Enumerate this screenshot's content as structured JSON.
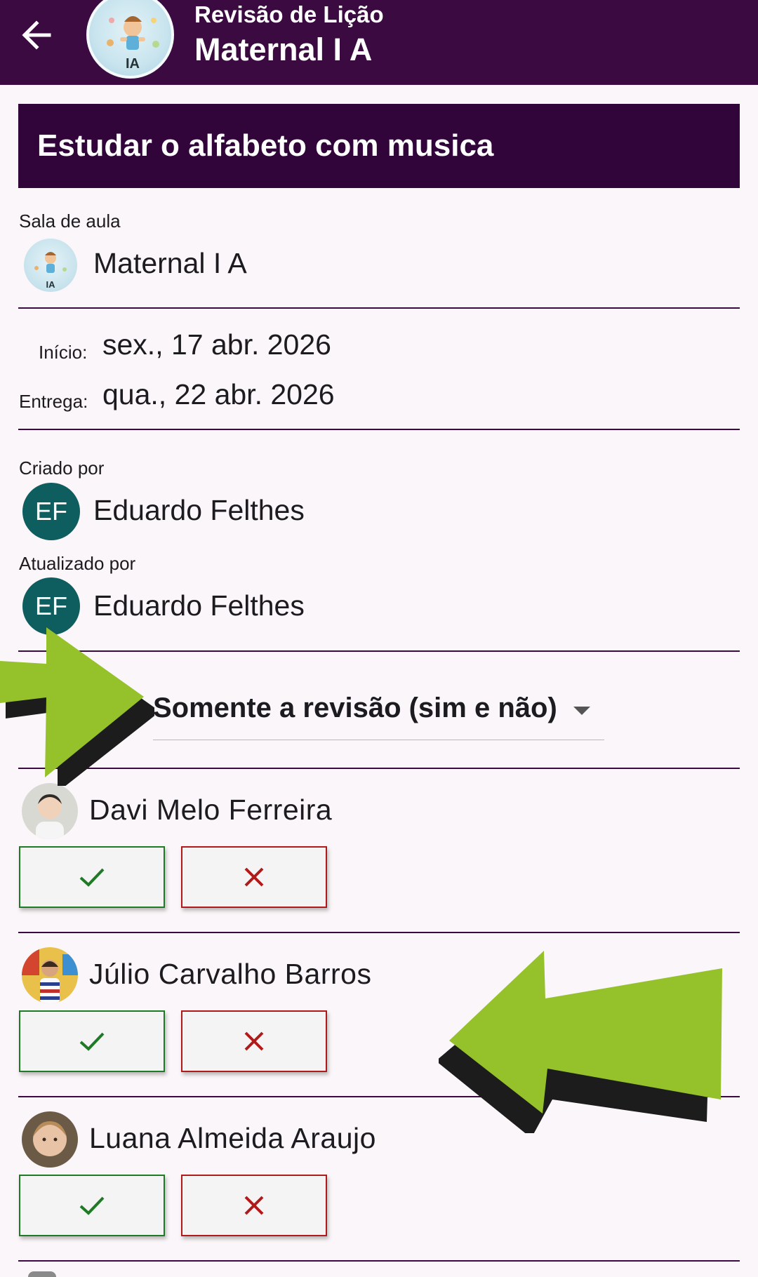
{
  "appbar": {
    "subtitle": "Revisão de Lição",
    "title": "Maternal I A",
    "avatar_text": "IA"
  },
  "lesson": {
    "title": "Estudar o alfabeto com musica"
  },
  "classroom": {
    "label": "Sala de aula",
    "name": "Maternal I A",
    "avatar_text": "IA"
  },
  "dates": {
    "start_label": "Início:",
    "start_value": "sex., 17 abr. 2026",
    "due_label": "Entrega:",
    "due_value": "qua., 22 abr. 2026"
  },
  "created_by": {
    "label": "Criado por",
    "initials": "EF",
    "name": "Eduardo Felthes"
  },
  "updated_by": {
    "label": "Atualizado por",
    "initials": "EF",
    "name": "Eduardo Felthes"
  },
  "filter": {
    "selected": "Somente a revisão (sim e não)"
  },
  "students": [
    {
      "name": "Davi Melo Ferreira"
    },
    {
      "name": "Júlio Carvalho Barros"
    },
    {
      "name": "Luana Almeida Araujo"
    }
  ],
  "icons": {
    "back": "arrow-left-icon",
    "yes": "check-icon",
    "no": "close-icon",
    "caret": "caret-down-icon"
  },
  "colors": {
    "appbar": "#3a0a40",
    "banner": "#31043a",
    "avatar": "#0e5d5f",
    "yes": "#1f7a26",
    "no": "#b01a1a",
    "highlight_arrow": "#95c22a"
  }
}
